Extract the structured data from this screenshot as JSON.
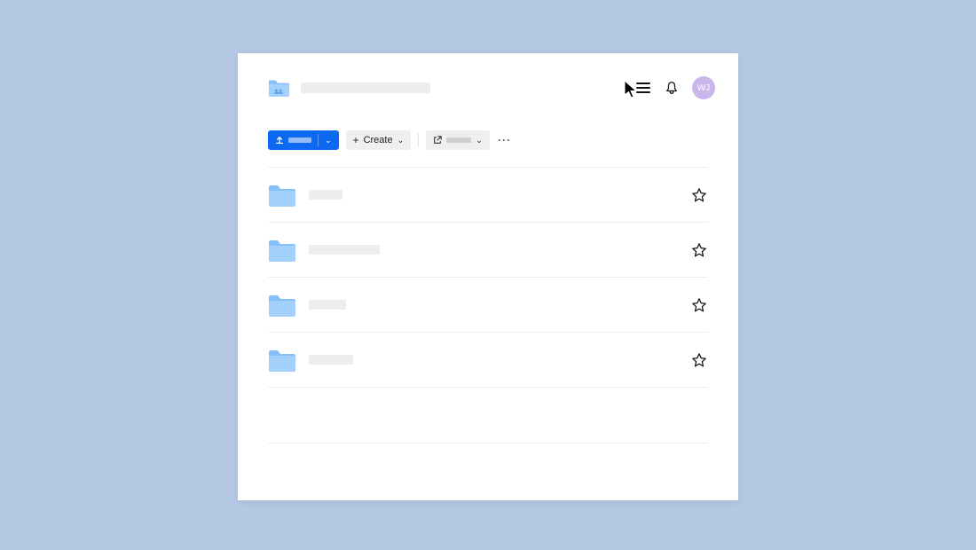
{
  "header": {
    "avatar_initials": "WJ",
    "colors": {
      "avatar_bg": "#c9b6ec"
    }
  },
  "toolbar": {
    "create_label": "Create",
    "create_chevron": "⌄",
    "upload_chevron": "⌄",
    "share_chevron": "⌄",
    "more_label": "···"
  },
  "list": {
    "rows": [
      {
        "ph_width": 38,
        "starred": false
      },
      {
        "ph_width": 80,
        "starred": false
      },
      {
        "ph_width": 42,
        "starred": false
      },
      {
        "ph_width": 50,
        "starred": false
      }
    ]
  },
  "colors": {
    "accent": "#0d69f2",
    "folder": "#a4d1fb",
    "folder_tab": "#a4d1fb"
  }
}
